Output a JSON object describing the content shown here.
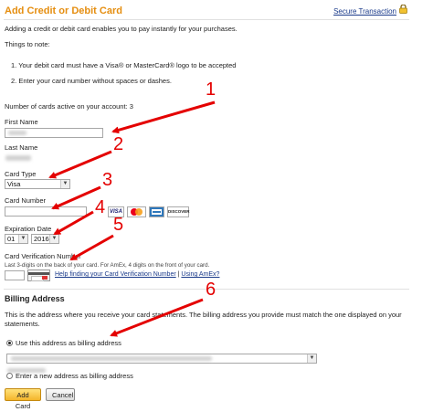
{
  "header": {
    "title": "Add Credit or Debit Card",
    "secure_link": "Secure Transaction"
  },
  "intro": {
    "text": "Adding a credit or debit card enables you to pay instantly for your purchases.",
    "notes_heading": "Things to note:",
    "note1": "1.  Your debit card must have a Visa® or MasterCard® logo to be accepted",
    "note2": "2.  Enter your card number without spaces or dashes."
  },
  "account": {
    "cards_active": "Number of cards active on your account: 3"
  },
  "form": {
    "first_name_label": "First Name",
    "last_name_label": "Last Name",
    "card_type_label": "Card Type",
    "card_type_value": "Visa",
    "card_number_label": "Card Number",
    "expiration_label": "Expiration Date",
    "exp_month": "01",
    "exp_year": "2016",
    "cvn_label": "Card Verification Number",
    "cvn_help_text": "Last 3-digits on the back of your card. For AmEx, 4 digits on the front of your card.",
    "cvn_help_link": "Help finding your Card Verification Number",
    "cvn_separator": " | ",
    "amex_link": "Using AmEx?"
  },
  "card_logos": {
    "visa": "VISA",
    "discover": "DISCOVER"
  },
  "billing": {
    "heading": "Billing Address",
    "desc": "This is the address where you receive your card statements. The billing address you provide must match the one displayed on your statements.",
    "use_this": "Use this address as billing address",
    "enter_new": "Enter a new address as billing address"
  },
  "buttons": {
    "add": "Add Card",
    "cancel": "Cancel"
  },
  "annotations": {
    "n1": "1",
    "n2": "2",
    "n3": "3",
    "n4": "4",
    "n5": "5",
    "n6": "6",
    "color": "#e40000"
  },
  "colors": {
    "title": "#e58e10",
    "link": "#1a3a8a"
  }
}
